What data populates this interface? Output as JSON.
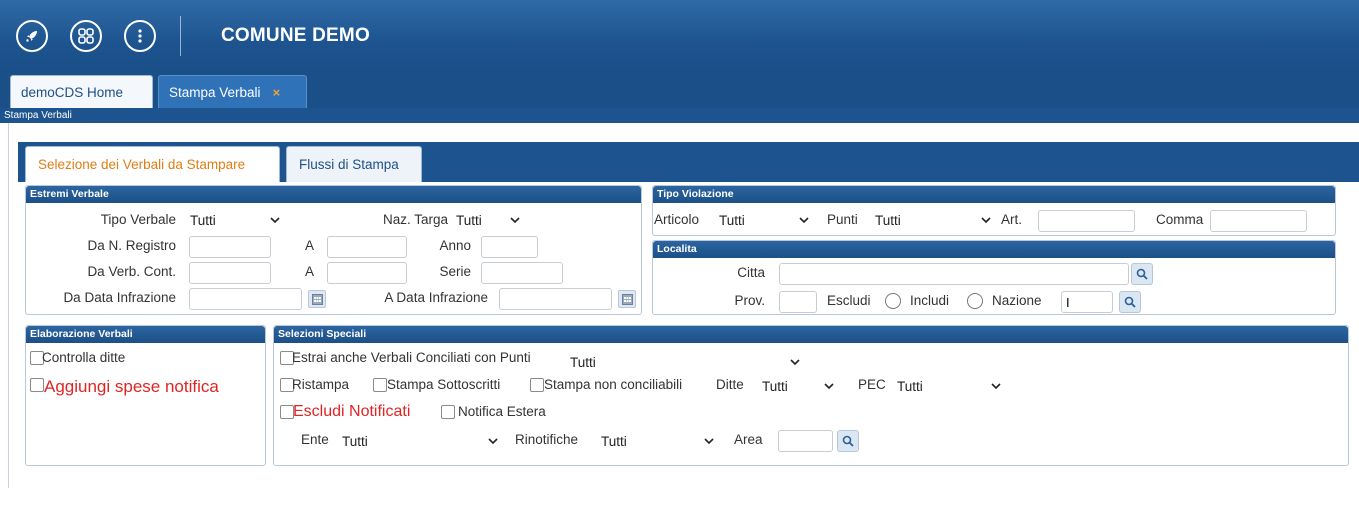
{
  "app": {
    "title": "COMUNE DEMO",
    "icons": [
      "rocket-icon",
      "apps-grid-icon",
      "info-icon"
    ]
  },
  "page_tabs": [
    {
      "label": "demoCDS Home",
      "active": false
    },
    {
      "label": "Stampa Verbali",
      "active": true,
      "close": "×"
    }
  ],
  "breadcrumb": "Stampa Verbali",
  "inner_tabs": [
    {
      "label": "Selezione dei Verbali da Stampare",
      "active": true
    },
    {
      "label": "Flussi di Stampa",
      "active": false
    }
  ],
  "estremi": {
    "title": "Estremi Verbale",
    "tipo_verbale_label": "Tipo Verbale",
    "tipo_verbale_value": "Tutti",
    "naz_targa_label": "Naz. Targa",
    "naz_targa_value": "Tutti",
    "da_registro_label": "Da N. Registro",
    "a_label": "A",
    "anno_label": "Anno",
    "da_verb_label": "Da Verb. Cont.",
    "serie_label": "Serie",
    "da_data_label": "Da Data Infrazione",
    "a_data_label": "A Data Infrazione"
  },
  "tipo_violazione": {
    "title": "Tipo Violazione",
    "articolo_label": "Articolo",
    "articolo_value": "Tutti",
    "punti_label": "Punti",
    "punti_value": "Tutti",
    "art_label": "Art.",
    "comma_label": "Comma"
  },
  "localita": {
    "title": "Localita",
    "citta_label": "Citta",
    "prov_label": "Prov.",
    "escludi_label": "Escludi",
    "includi_label": "Includi",
    "nazione_label": "Nazione",
    "nazione_value": "I"
  },
  "elaborazione": {
    "title": "Elaborazione Verbali",
    "controlla_ditte": "Controlla ditte",
    "aggiungi_spese": "Aggiungi spese notifica"
  },
  "selezioni": {
    "title": "Selezioni Speciali",
    "estrai_label": "Estrai anche Verbali Conciliati con Punti",
    "estrai_value": "Tutti",
    "ristampa": "Ristampa",
    "stampa_sottoscritti": "Stampa Sottoscritti",
    "stampa_non_conciliabili": "Stampa non conciliabili",
    "ditte_label": "Ditte",
    "ditte_value": "Tutti",
    "pec_label": "PEC",
    "pec_value": "Tutti",
    "escludi_notificati": "Escludi Notificati",
    "notifica_estera": "Notifica Estera",
    "ente_label": "Ente",
    "ente_value": "Tutti",
    "rinotifiche_label": "Rinotifiche",
    "rinotifiche_value": "Tutti",
    "area_label": "Area"
  },
  "colors": {
    "header_blue": "#1d548f",
    "active_tab_orange": "#e07d16",
    "alert_red": "#e02424"
  }
}
